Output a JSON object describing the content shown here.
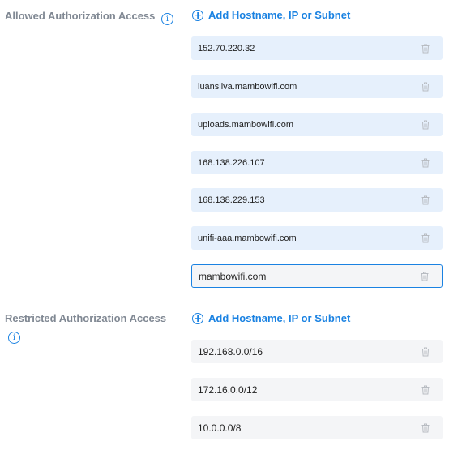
{
  "allowed": {
    "label": "Allowed Authorization Access",
    "add_label": "Add Hostname, IP or Subnet",
    "entries": [
      "152.70.220.32",
      "luansilva.mambowifi.com",
      "uploads.mambowifi.com",
      "168.138.226.107",
      "168.138.229.153",
      "unifi-aaa.mambowifi.com",
      "mambowifi.com"
    ]
  },
  "restricted": {
    "label": "Restricted Authorization Access",
    "add_label": "Add Hostname, IP or Subnet",
    "entries": [
      "192.168.0.0/16",
      "172.16.0.0/12",
      "10.0.0.0/8"
    ]
  },
  "icons": {
    "info": "info-icon",
    "add": "plus-circle-icon",
    "delete": "trash-icon"
  },
  "colors": {
    "accent": "#1a82e2",
    "label": "#808893",
    "allowed_row_bg": "#e6f0fc",
    "restricted_row_bg": "#f4f5f7"
  }
}
